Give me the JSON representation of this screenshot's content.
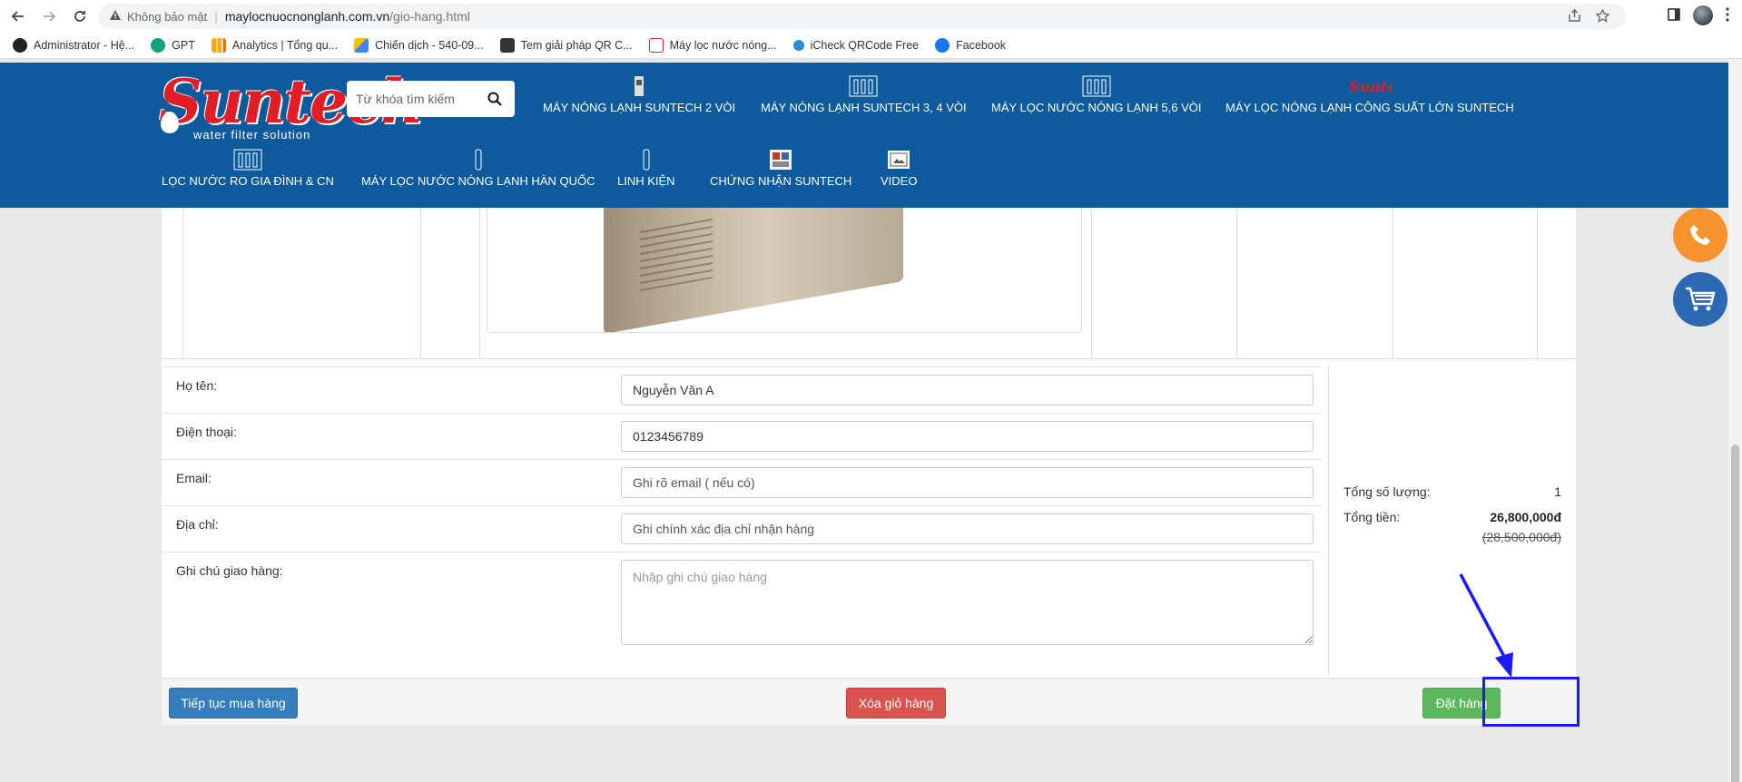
{
  "browser": {
    "security_label": "Không bảo mật",
    "url_host": "maylocnuocnonglanh.com.vn",
    "url_path": "/gio-hang.html"
  },
  "bookmarks": [
    {
      "label": "Administrator - Hệ...",
      "color": "#222222"
    },
    {
      "label": "GPT",
      "color": "#10a37f"
    },
    {
      "label": "Analytics | Tổng qu...",
      "color": "#f9ab00"
    },
    {
      "label": "Chiến dịch - 540-09...",
      "color": "#4285f4"
    },
    {
      "label": "Tem giải pháp QR C...",
      "color": "#333333"
    },
    {
      "label": "Máy lọc nước nóng...",
      "color": "#e11d25"
    },
    {
      "label": "iCheck QRCode Free",
      "color": "#2a8bd6"
    },
    {
      "label": "Facebook",
      "color": "#1877f2"
    }
  ],
  "site": {
    "logo_text": "Suntech",
    "logo_sub": "water filter solution",
    "search_placeholder": "Từ khóa tìm kiếm",
    "nav": [
      "MÁY NÓNG LẠNH SUNTECH 2 VÒI",
      "MÁY NÓNG LẠNH SUNTECH 3, 4 VÒI",
      "MÁY LỌC NƯỚC NÓNG LẠNH 5,6 VÒI",
      "MÁY LỌC NÓNG LẠNH CÔNG SUẤT LỚN SUNTECH",
      "LỌC NƯỚC RO GIA ĐÌNH & CN",
      "MÁY LỌC NƯỚC NÓNG LẠNH HÀN QUỐC",
      "LINH KIỆN",
      "CHỨNG NHẬN SUNTECH",
      "VIDEO"
    ]
  },
  "form": {
    "name_label": "Họ tên:",
    "name_value": "Nguyễn Văn A",
    "phone_label": "Điện thoại:",
    "phone_value": "0123456789",
    "email_label": "Email:",
    "email_placeholder": "Ghi rõ email ( nếu có)",
    "address_label": "Địa chỉ:",
    "address_placeholder": "Ghi chính xác địa chỉ nhận hàng",
    "note_label": "Ghi chú giao hàng:",
    "note_placeholder": "Nhập ghi chú giao hàng"
  },
  "summary": {
    "qty_label": "Tổng số lượng:",
    "qty_value": "1",
    "total_label": "Tổng tiền:",
    "total_value": "26,800,000đ",
    "old_total": "(28,500,000đ)"
  },
  "actions": {
    "continue": "Tiếp tục mua hàng",
    "clear": "Xóa giỏ hàng",
    "order": "Đặt hàng"
  },
  "colors": {
    "header_bg": "#0d5a9c",
    "logo_red": "#e11d25",
    "btn_blue": "#357ebd",
    "btn_red": "#d9534f",
    "btn_green": "#5cb85c",
    "annotation_blue": "#1a1aff",
    "phone_orange": "#f7932f"
  }
}
